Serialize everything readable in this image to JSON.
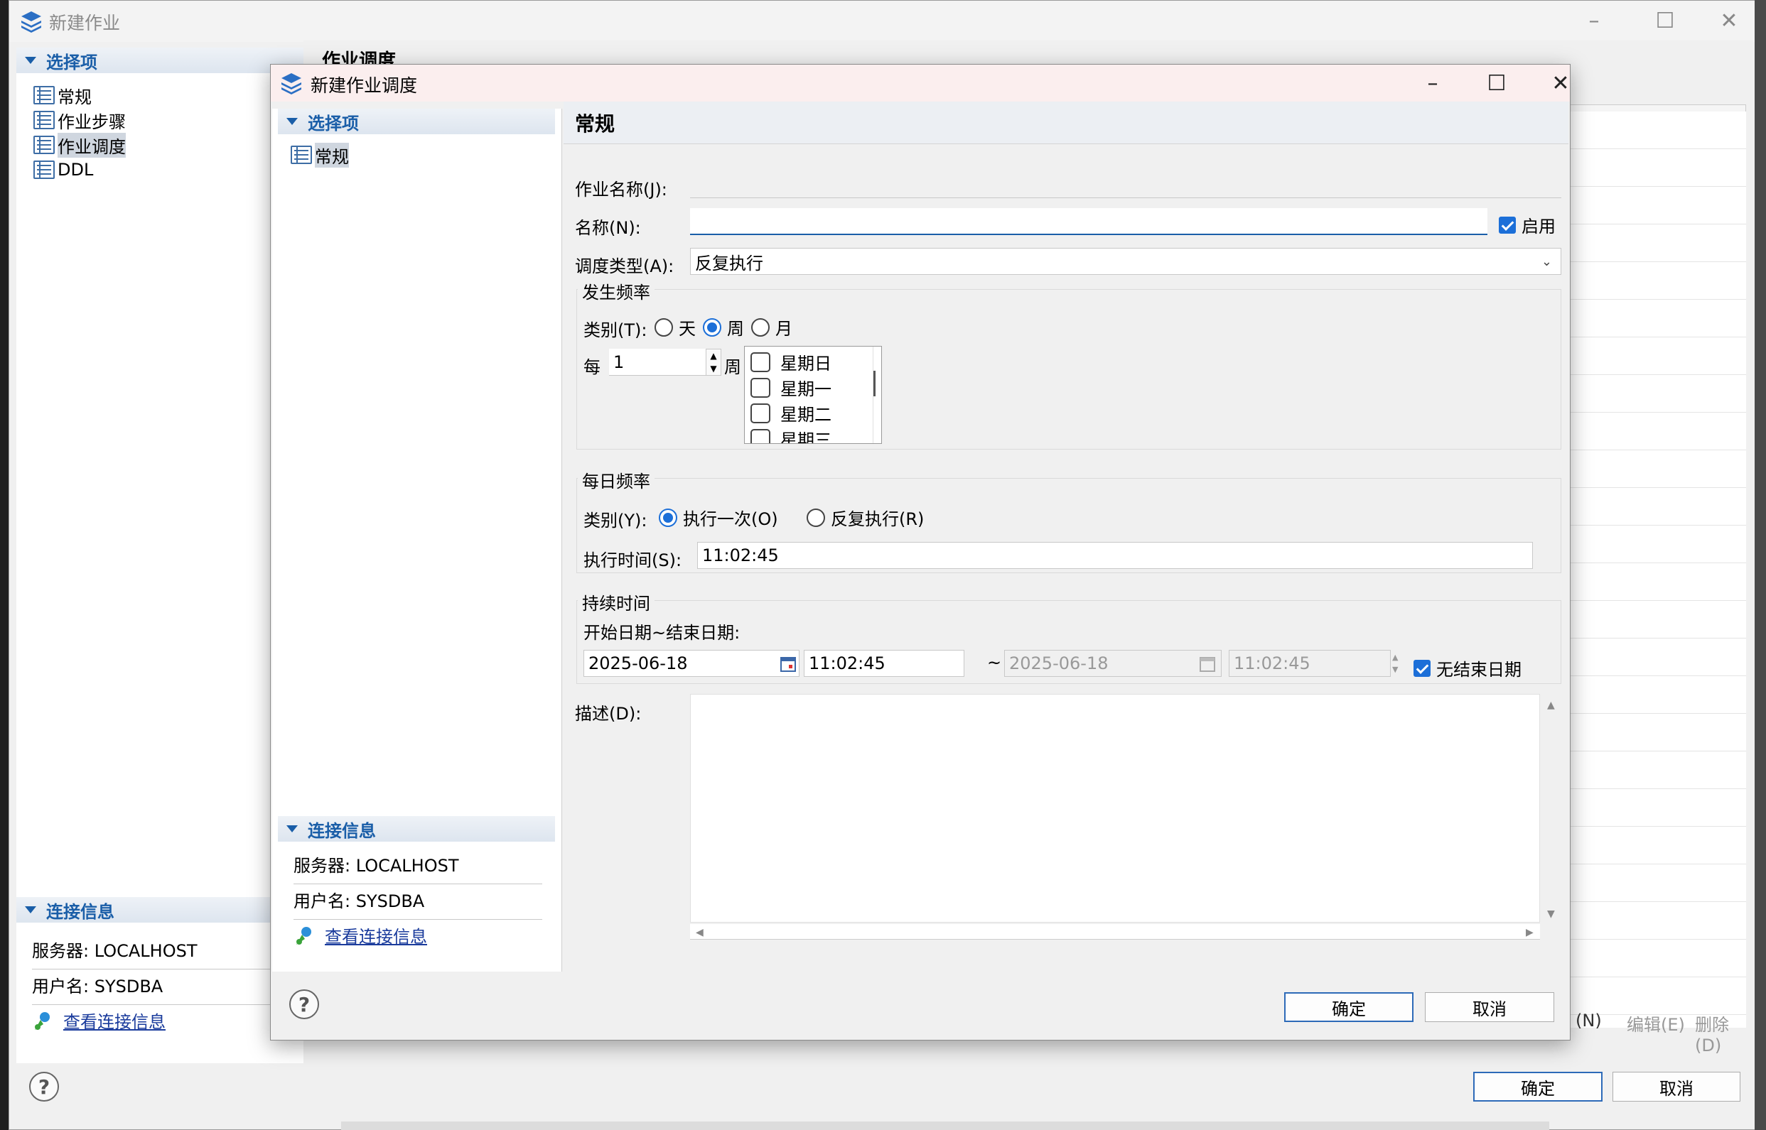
{
  "outer_window": {
    "title": "新建作业",
    "tree_header": "选择项",
    "tree_items": [
      "常规",
      "作业步骤",
      "作业调度",
      "DDL"
    ],
    "right_title": "作业调度",
    "conn_header": "连接信息",
    "server": "服务器: LOCALHOST",
    "username": "用户名: SYSDBA",
    "view_conn": "查看连接信息",
    "ok": "确定",
    "cancel": "取消",
    "grid_new": "(N)",
    "grid_edit": "编辑(E)",
    "grid_delete": "删除(D)"
  },
  "dialog": {
    "title": "新建作业调度",
    "tree_header": "选择项",
    "tree_items": [
      "常规"
    ],
    "section_title": "常规",
    "conn_header": "连接信息",
    "server": "服务器: LOCALHOST",
    "username": "用户名: SYSDBA",
    "view_conn": "查看连接信息",
    "job_name_label": "作业名称(J):",
    "job_name_value": "",
    "name_label": "名称(N):",
    "name_value": "",
    "enabled_label": "启用",
    "enabled": true,
    "schedule_type_label": "调度类型(A):",
    "schedule_type_value": "反复执行",
    "frequency": {
      "title": "发生频率",
      "type_label": "类别(T):",
      "options": [
        "天",
        "周",
        "月"
      ],
      "selected": "周",
      "every_label": "每",
      "every_value": "1",
      "unit": "周",
      "days": [
        "星期日",
        "星期一",
        "星期二",
        "星期三"
      ]
    },
    "daily": {
      "title": "每日频率",
      "type_label": "类别(Y):",
      "options": [
        "执行一次(O)",
        "反复执行(R)"
      ],
      "selected": "执行一次(O)",
      "time_label": "执行时间(S):",
      "time_value": "11:02:45"
    },
    "duration": {
      "title": "持续时间",
      "range_label": "开始日期~结束日期:",
      "start_date": "2025-06-18",
      "start_time": "11:02:45",
      "tilde": "~",
      "end_date": "2025-06-18",
      "end_time": "11:02:45",
      "no_end_label": "无结束日期",
      "no_end": true
    },
    "desc_label": "描述(D):",
    "desc_value": "",
    "ok": "确定",
    "cancel": "取消"
  },
  "colors": {
    "accent": "#1c6fd8",
    "link": "#1a3b9c",
    "section_header_text": "#1a5ea8",
    "dialog_titlebar": "#fbeeee"
  }
}
